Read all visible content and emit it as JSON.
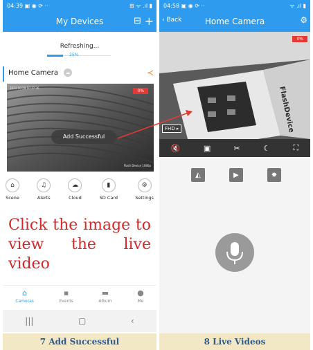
{
  "left": {
    "status_time": "04:39",
    "status_icons": "▣ ◉ ⟳ ··",
    "status_right": "⊞ ᯤ .ıl ▮",
    "title": "My Devices",
    "refresh_text": "Refreshing...",
    "refresh_percent": "25%",
    "refresh_fraction": 0.25,
    "device_name": "Home Camera",
    "feed_badge": "0%",
    "feed_overlay_text": "Add Successful",
    "feed_timestamp": "2023-10-28 10:37:36",
    "feed_watermark": "Flash Device 1080p",
    "features": [
      {
        "label": "Scene",
        "icon": "home-icon",
        "glyph": "⌂"
      },
      {
        "label": "Alerts",
        "icon": "bell-icon",
        "glyph": "🔔"
      },
      {
        "label": "Cloud",
        "icon": "cloud-icon",
        "glyph": "☁"
      },
      {
        "label": "SD Card",
        "icon": "sd-card-icon",
        "glyph": "▮"
      },
      {
        "label": "Settings",
        "icon": "gear-icon",
        "glyph": "⚙"
      }
    ],
    "instruction": "Click the image to view the live video",
    "tabs": [
      {
        "label": "Cameras",
        "icon": "home-icon",
        "glyph": "⌂",
        "active": true
      },
      {
        "label": "Events",
        "icon": "chat-icon",
        "glyph": "▪"
      },
      {
        "label": "Album",
        "icon": "album-icon",
        "glyph": "▬"
      },
      {
        "label": "Me",
        "icon": "person-icon",
        "glyph": "●"
      }
    ],
    "caption": "7 Add Successful"
  },
  "right": {
    "status_time": "04:58",
    "status_icons": "▣ ◉ ⟳ ··",
    "status_right": "ᯤ .ıl ▮",
    "back_label": "Back",
    "title": "Home Camera",
    "feed_badge": "0%",
    "fhd_label": "FHD ▸",
    "box_label": "FlashDevice",
    "controls": [
      {
        "name": "mute-icon",
        "glyph": "🔇"
      },
      {
        "name": "record-icon",
        "glyph": "▣"
      },
      {
        "name": "scissors-icon",
        "glyph": "✂"
      },
      {
        "name": "night-mode-icon",
        "glyph": "☾"
      },
      {
        "name": "fullscreen-icon",
        "glyph": "⛶"
      }
    ],
    "ptz_buttons": [
      {
        "name": "flip-icon",
        "glyph": "◭"
      },
      {
        "name": "mirror-icon",
        "glyph": "▶"
      },
      {
        "name": "light-icon",
        "glyph": "✸"
      }
    ],
    "caption": "8 Live Videos"
  },
  "colors": {
    "accent": "#2f9bef",
    "alert": "#e53935",
    "caption_bg": "#f3e8c5",
    "caption_text": "#2e5a93",
    "instruction": "#d62828"
  }
}
